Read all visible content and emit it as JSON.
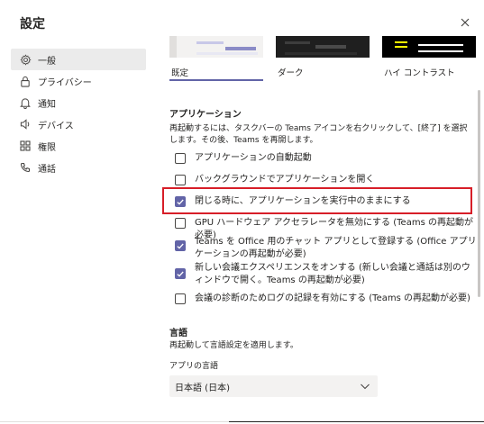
{
  "dialog": {
    "title": "設定",
    "close_icon": "close-icon"
  },
  "sidebar": {
    "items": [
      {
        "label": "一般",
        "icon": "gear-icon",
        "active": true
      },
      {
        "label": "プライバシー",
        "icon": "lock-icon"
      },
      {
        "label": "通知",
        "icon": "bell-icon"
      },
      {
        "label": "デバイス",
        "icon": "speaker-icon"
      },
      {
        "label": "権限",
        "icon": "grid-icon"
      },
      {
        "label": "通話",
        "icon": "phone-icon"
      }
    ]
  },
  "themes": [
    {
      "label": "既定",
      "selected": true
    },
    {
      "label": "ダーク"
    },
    {
      "label": "ハイ コントラスト"
    }
  ],
  "application": {
    "title": "アプリケーション",
    "description": "再起動するには、タスクバーの Teams アイコンを右クリックして、[終了] を選択します。その後、Teams を再開します。",
    "options": [
      {
        "label": "アプリケーションの自動起動",
        "checked": false
      },
      {
        "label": "バックグラウンドでアプリケーションを開く",
        "checked": false
      },
      {
        "label": "閉じる時に、アプリケーションを実行中のままにする",
        "checked": true
      },
      {
        "label": "GPU ハードウェア アクセラレータを無効にする (Teams の再起動が必要)",
        "checked": false
      },
      {
        "label": "Teams を Office 用のチャット アプリとして登録する (Office アプリケーションの再起動が必要)",
        "checked": true
      },
      {
        "label": "新しい会議エクスペリエンスをオンする (新しい会議と通話は別のウィンドウで開く。Teams の再起動が必要)",
        "checked": true
      },
      {
        "label": "会議の診断のためログの記録を有効にする (Teams の再起動が必要)",
        "checked": false
      }
    ]
  },
  "language": {
    "title": "言語",
    "description": "再起動して言語設定を適用します。",
    "app_language_label": "アプリの言語",
    "app_language_value": "日本語 (日本)"
  },
  "colors": {
    "accent": "#6264a7",
    "highlight": "#d71e28"
  }
}
